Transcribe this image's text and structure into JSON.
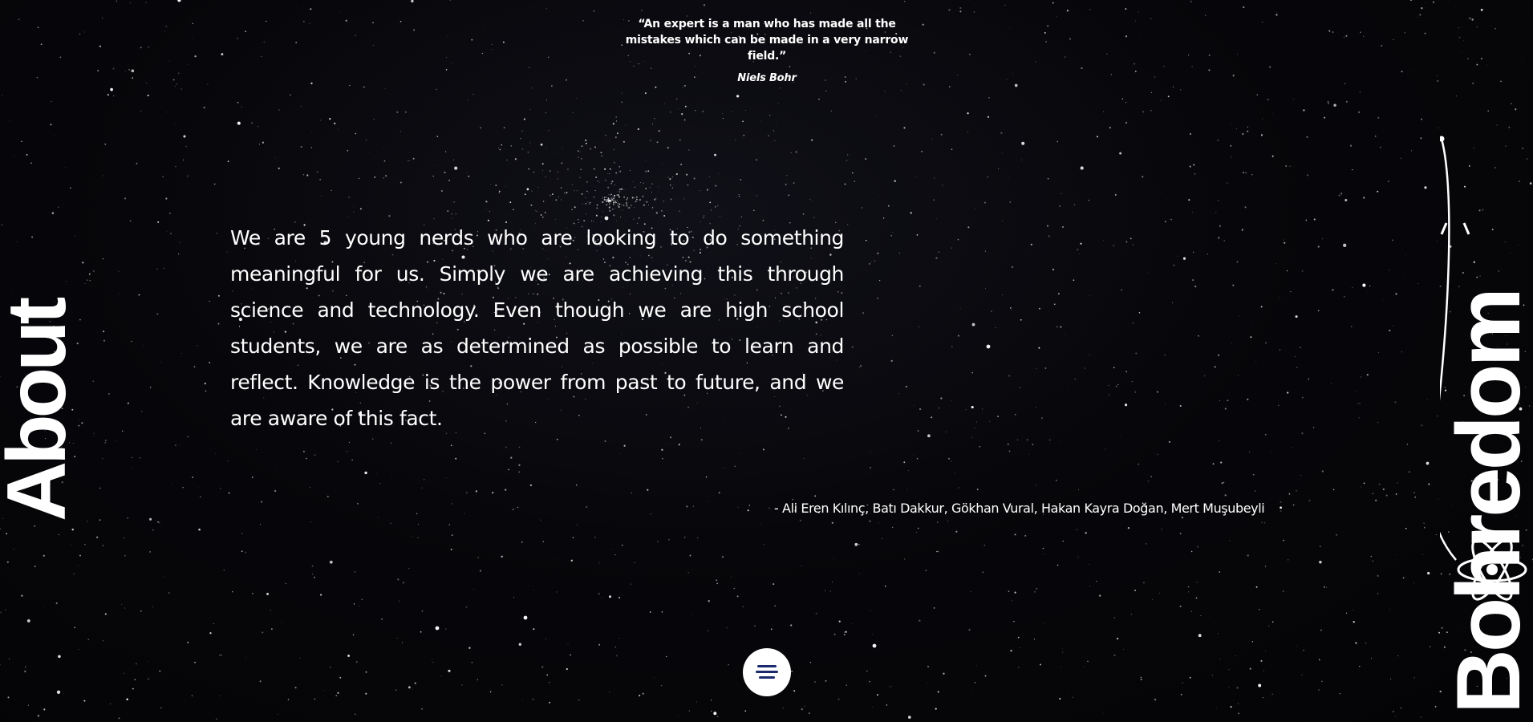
{
  "quote": {
    "text": "“An expert is a man who has made all the mistakes which can be made in a very narrow field.”",
    "author": "Niels Bohr"
  },
  "section_title": "About",
  "about_text": "We are 5 young nerds who are looking to do something meaningful for us. Simply we are achieving this through science and technology. Even though we are high school students, we are as determined as possible to learn and reflect. Knowledge is the power from past to future, and we are aware of this fact.",
  "authors": "- Ali Eren Kılınç, Batı Dakkur, Gökhan Vural, Hakan Kayra Doğan, Mert Muşubeyli",
  "brand": {
    "name": "Bohredom",
    "icon": "atom-icon"
  },
  "menu": {
    "icon": "hamburger-menu-icon"
  },
  "colors": {
    "background": "#050507",
    "text": "#ffffff",
    "menu_icon": "#1a2a6c",
    "menu_button": "#ffffff"
  }
}
